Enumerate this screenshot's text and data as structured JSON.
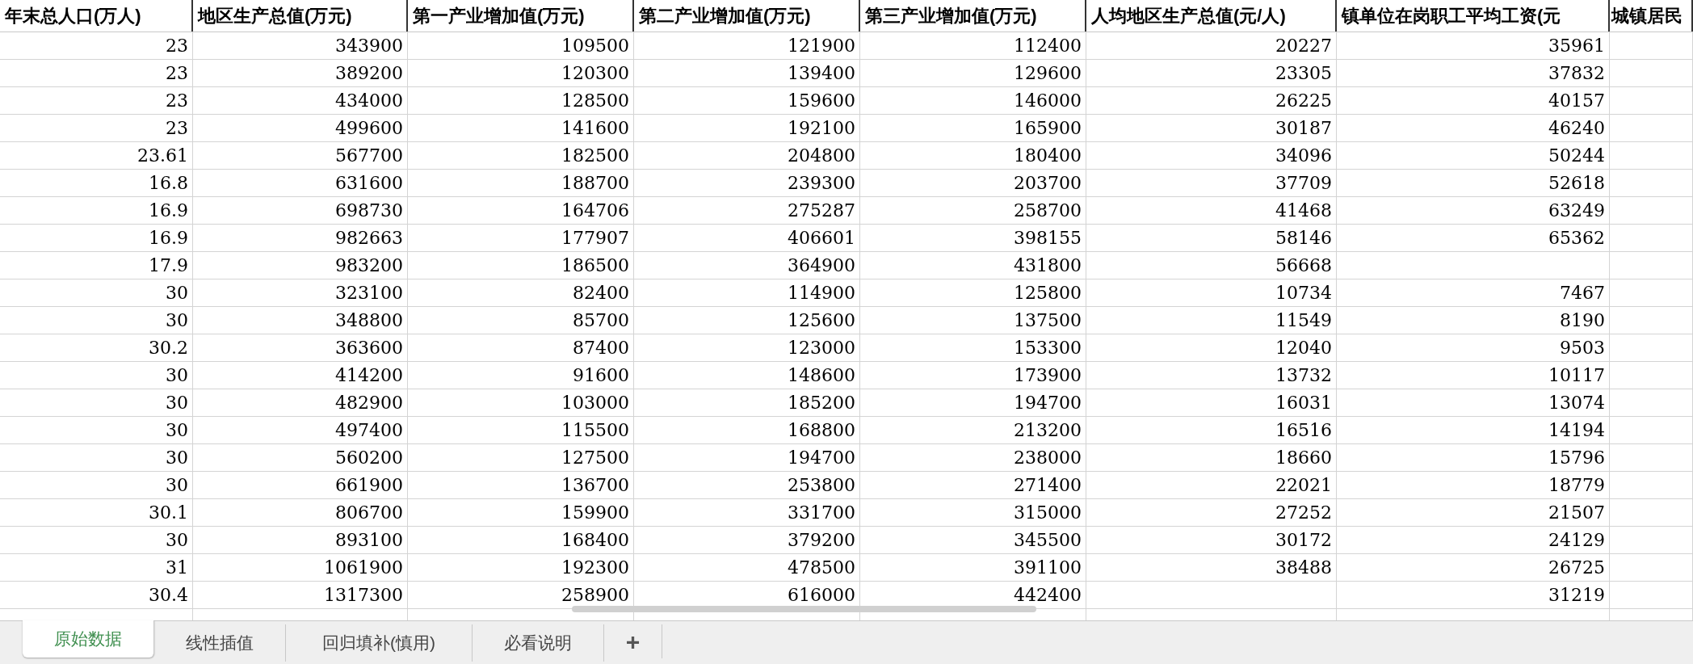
{
  "columns": [
    "年末总人口(万人)",
    "地区生产总值(万元)",
    "第一产业增加值(万元)",
    "第二产业增加值(万元)",
    "第三产业增加值(万元)",
    "人均地区生产总值(元/人)",
    "镇单位在岗职工平均工资(元",
    "城镇居民"
  ],
  "rows": [
    [
      "23",
      "343900",
      "109500",
      "121900",
      "112400",
      "20227",
      "35961"
    ],
    [
      "23",
      "389200",
      "120300",
      "139400",
      "129600",
      "23305",
      "37832"
    ],
    [
      "23",
      "434000",
      "128500",
      "159600",
      "146000",
      "26225",
      "40157"
    ],
    [
      "23",
      "499600",
      "141600",
      "192100",
      "165900",
      "30187",
      "46240"
    ],
    [
      "23.61",
      "567700",
      "182500",
      "204800",
      "180400",
      "34096",
      "50244"
    ],
    [
      "16.8",
      "631600",
      "188700",
      "239300",
      "203700",
      "37709",
      "52618"
    ],
    [
      "16.9",
      "698730",
      "164706",
      "275287",
      "258700",
      "41468",
      "63249"
    ],
    [
      "16.9",
      "982663",
      "177907",
      "406601",
      "398155",
      "58146",
      "65362"
    ],
    [
      "17.9",
      "983200",
      "186500",
      "364900",
      "431800",
      "56668",
      null
    ],
    [
      "30",
      "323100",
      "82400",
      "114900",
      "125800",
      "10734",
      "7467"
    ],
    [
      "30",
      "348800",
      "85700",
      "125600",
      "137500",
      "11549",
      "8190"
    ],
    [
      "30.2",
      "363600",
      "87400",
      "123000",
      "153300",
      "12040",
      "9503"
    ],
    [
      "30",
      "414200",
      "91600",
      "148600",
      "173900",
      "13732",
      "10117"
    ],
    [
      "30",
      "482900",
      "103000",
      "185200",
      "194700",
      "16031",
      "13074"
    ],
    [
      "30",
      "497400",
      "115500",
      "168800",
      "213200",
      "16516",
      "14194"
    ],
    [
      "30",
      "560200",
      "127500",
      "194700",
      "238000",
      "18660",
      "15796"
    ],
    [
      "30",
      "661900",
      "136700",
      "253800",
      "271400",
      "22021",
      "18779"
    ],
    [
      "30.1",
      "806700",
      "159900",
      "331700",
      "315000",
      "27252",
      "21507"
    ],
    [
      "30",
      "893100",
      "168400",
      "379200",
      "345500",
      "30172",
      "24129"
    ],
    [
      "31",
      "1061900",
      "192300",
      "478500",
      "391100",
      "38488",
      "26725"
    ],
    [
      "30.4",
      "1317300",
      "258900",
      "616000",
      "442400",
      null,
      "31219"
    ]
  ],
  "sheet_tabs": [
    {
      "label": "原始数据",
      "selected": true
    },
    {
      "label": "线性插值",
      "selected": false
    },
    {
      "label": "回归填补(慎用)",
      "selected": false
    },
    {
      "label": "必看说明",
      "selected": false
    }
  ],
  "add_sheet_button": "+"
}
